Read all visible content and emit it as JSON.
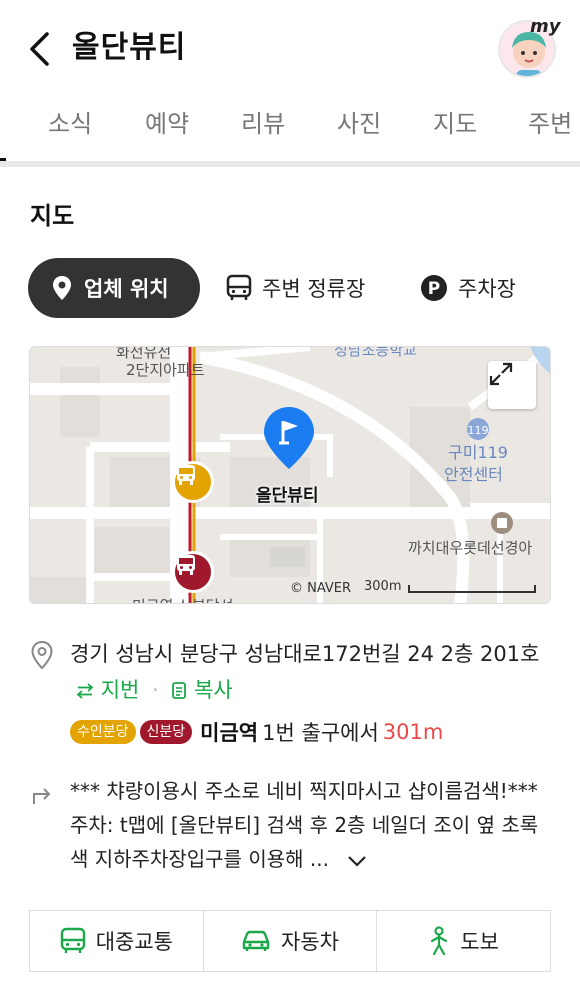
{
  "header": {
    "title": "올단뷰티",
    "avatar_label": "my"
  },
  "tabs": [
    {
      "label": "소식"
    },
    {
      "label": "예약"
    },
    {
      "label": "리뷰"
    },
    {
      "label": "사진"
    },
    {
      "label": "지도"
    },
    {
      "label": "주변"
    }
  ],
  "map_section": {
    "title": "지도",
    "filters": [
      {
        "label": "업체 위치",
        "icon": "location-pin-icon",
        "active": true
      },
      {
        "label": "주변 정류장",
        "icon": "bus-icon",
        "active": false
      },
      {
        "label": "주차장",
        "icon": "parking-icon",
        "active": false
      }
    ],
    "map": {
      "place_label": "올단뷰티",
      "labels": [
        "화전유전",
        "2단지아파트",
        "성남초등학교",
        "구미119",
        "안전센터",
        "까치대우롯데선경아",
        "미금역 신분당선"
      ],
      "credit": "© NAVER",
      "scale": "300m"
    }
  },
  "info": {
    "address": "경기 성남시 분당구 성남대로172번길 24 2층 201호",
    "jibun_label": "지번",
    "copy_label": "복사",
    "station": {
      "badges": [
        {
          "label": "수인분당",
          "color": "#e3a300"
        },
        {
          "label": "신분당",
          "color": "#a0182c"
        }
      ],
      "name": "미금역",
      "exit": "1번 출구에서",
      "distance": "301m"
    },
    "directions": "*** 챠량이용시 주소로 네비 찍지마시고 샵이름검색!*** 주차: t맵에 [올단뷰티] 검색 후 2층 네일더 조이 옆 초록색 지하주차장입구를 이용해 ..."
  },
  "routes": [
    {
      "label": "대중교통",
      "icon": "transit-icon"
    },
    {
      "label": "자동차",
      "icon": "car-icon"
    },
    {
      "label": "도보",
      "icon": "walk-icon"
    }
  ],
  "colors": {
    "accent_green": "#1ba84a",
    "distance_red": "#e84a4a",
    "pin_blue": "#1a7cf0"
  }
}
